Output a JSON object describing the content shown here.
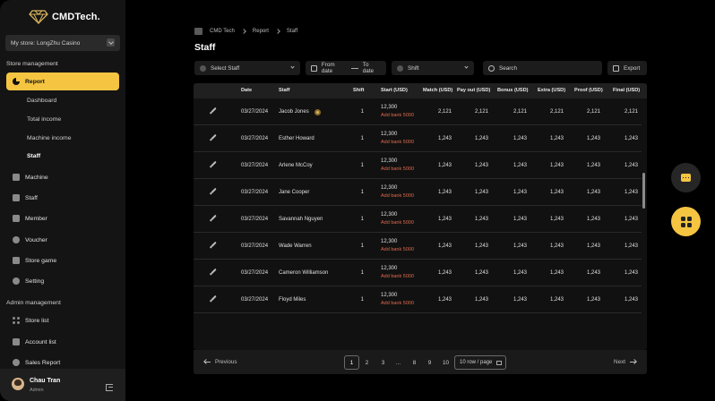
{
  "app": {
    "name": "CMDTech."
  },
  "store_selector": {
    "value": "My store: LongZhu Casino"
  },
  "sidebar": {
    "section_store": "Store management",
    "report_label": "Report",
    "report_sub": [
      "Dashboard",
      "Total income",
      "Machine income",
      "Staff"
    ],
    "store_items": [
      "Machine",
      "Staff",
      "Member",
      "Voucher",
      "Store game",
      "Setting"
    ],
    "section_admin": "Admin management",
    "admin_items": [
      "Store list",
      "Account list",
      "Sales Report"
    ]
  },
  "user": {
    "name": "Chau Tran",
    "role": "Admin"
  },
  "breadcrumb": [
    "CMD Tech",
    "Report",
    "Staff"
  ],
  "page_title": "Staff",
  "filters": {
    "staff": "Select Staff",
    "from_date": "From date",
    "to_date": "To date",
    "shift": "Shift",
    "search_placeholder": "Search",
    "export": "Export"
  },
  "table": {
    "columns": [
      "Date",
      "Staff",
      "Shift",
      "Start (USD)",
      "Match (USD)",
      "Pay out (USD)",
      "Bonus (USD)",
      "Extra (USD)",
      "Proof (USD)",
      "Final (USD)"
    ],
    "rows": [
      {
        "date": "03/27/2024",
        "staff": "Jacob Jones",
        "shift": "1",
        "start": "12,300",
        "note": "Add bank 5000",
        "match": "2,121",
        "payout": "2,121",
        "bonus": "2,121",
        "extra": "2,121",
        "proof": "2,121",
        "final": "2,121"
      },
      {
        "date": "03/27/2024",
        "staff": "Esther Howard",
        "shift": "1",
        "start": "12,300",
        "note": "Add bank 5000",
        "match": "1,243",
        "payout": "1,243",
        "bonus": "1,243",
        "extra": "1,243",
        "proof": "1,243",
        "final": "1,243"
      },
      {
        "date": "03/27/2024",
        "staff": "Arlene McCoy",
        "shift": "1",
        "start": "12,300",
        "note": "Add bank 5000",
        "match": "1,243",
        "payout": "1,243",
        "bonus": "1,243",
        "extra": "1,243",
        "proof": "1,243",
        "final": "1,243"
      },
      {
        "date": "03/27/2024",
        "staff": "Jane Cooper",
        "shift": "1",
        "start": "12,300",
        "note": "Add bank 5000",
        "match": "1,243",
        "payout": "1,243",
        "bonus": "1,243",
        "extra": "1,243",
        "proof": "1,243",
        "final": "1,243"
      },
      {
        "date": "03/27/2024",
        "staff": "Savannah Nguyen",
        "shift": "1",
        "start": "12,300",
        "note": "Add bank 5000",
        "match": "1,243",
        "payout": "1,243",
        "bonus": "1,243",
        "extra": "1,243",
        "proof": "1,243",
        "final": "1,243"
      },
      {
        "date": "03/27/2024",
        "staff": "Wade Warren",
        "shift": "1",
        "start": "12,300",
        "note": "Add bank 5000",
        "match": "1,243",
        "payout": "1,243",
        "bonus": "1,243",
        "extra": "1,243",
        "proof": "1,243",
        "final": "1,243"
      },
      {
        "date": "03/27/2024",
        "staff": "Cameron Williamson",
        "shift": "1",
        "start": "12,300",
        "note": "Add bank 5000",
        "match": "1,243",
        "payout": "1,243",
        "bonus": "1,243",
        "extra": "1,243",
        "proof": "1,243",
        "final": "1,243"
      },
      {
        "date": "03/27/2024",
        "staff": "Floyd Miles",
        "shift": "1",
        "start": "12,300",
        "note": "Add bank 5000",
        "match": "1,243",
        "payout": "1,243",
        "bonus": "1,243",
        "extra": "1,243",
        "proof": "1,243",
        "final": "1,243"
      }
    ]
  },
  "pagination": {
    "prev": "Previous",
    "next": "Next",
    "pages": [
      "1",
      "2",
      "3",
      "...",
      "8",
      "9",
      "10"
    ],
    "current": "1",
    "per_page": "10 row / page"
  },
  "colors": {
    "accent": "#f5c542",
    "bank_note": "#e0694d",
    "background": "#000000",
    "sidebar": "#141414"
  },
  "icons": [
    "diamond-logo-icon",
    "chevron-down-icon",
    "report-icon",
    "machine-icon",
    "staff-icon",
    "member-icon",
    "voucher-icon",
    "store-game-icon",
    "setting-icon",
    "store-list-icon",
    "account-list-icon",
    "sales-report-icon",
    "logout-icon",
    "home-icon",
    "calendar-icon",
    "search-icon",
    "export-icon",
    "edit-icon",
    "chat-icon",
    "apps-icon"
  ]
}
